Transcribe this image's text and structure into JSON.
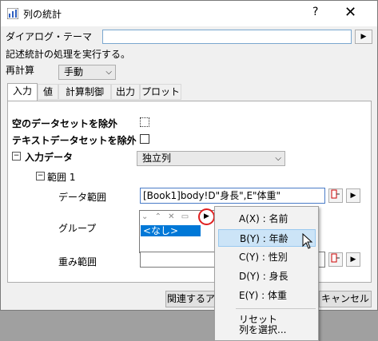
{
  "window": {
    "title": "列の統計",
    "help_label": "?",
    "close_label": "✕"
  },
  "theme": {
    "label": "ダイアログ・テーマ",
    "value": ""
  },
  "description": "記述統計の処理を実行する。",
  "recalc": {
    "label": "再計算",
    "value": "手動"
  },
  "tabs": [
    "入力",
    "値",
    "計算制御",
    "出力",
    "プロット"
  ],
  "input_tab": {
    "exclude_empty": "空のデータセットを除外",
    "exclude_text": "テキストデータセットを除外",
    "input_data_label": "入力データ",
    "input_data_value": "独立列",
    "range_label": "範囲 1",
    "data_range_label": "データ範囲",
    "data_range_value": "[Book1]body!D\"身長\",E\"体重\"",
    "group_label": "グループ",
    "group_value": "<なし>",
    "weight_label": "重み範囲",
    "weight_value": ""
  },
  "buttons": {
    "related": "関連するア",
    "cancel": "キャンセル"
  },
  "group_toolbar": [
    "⌄",
    "⌃",
    "✕",
    "▭"
  ],
  "context_menu": {
    "items": [
      "A(X) : 名前",
      "B(Y) : 年齢",
      "C(Y) : 性別",
      "D(Y) : 身長",
      "E(Y) : 体重"
    ],
    "actions": [
      "リセット",
      "列を選択..."
    ],
    "highlighted_index": 1
  },
  "colors": {
    "accent_highlight": "#cce4f7",
    "selection": "#0078d7",
    "marker": "#e02020"
  }
}
